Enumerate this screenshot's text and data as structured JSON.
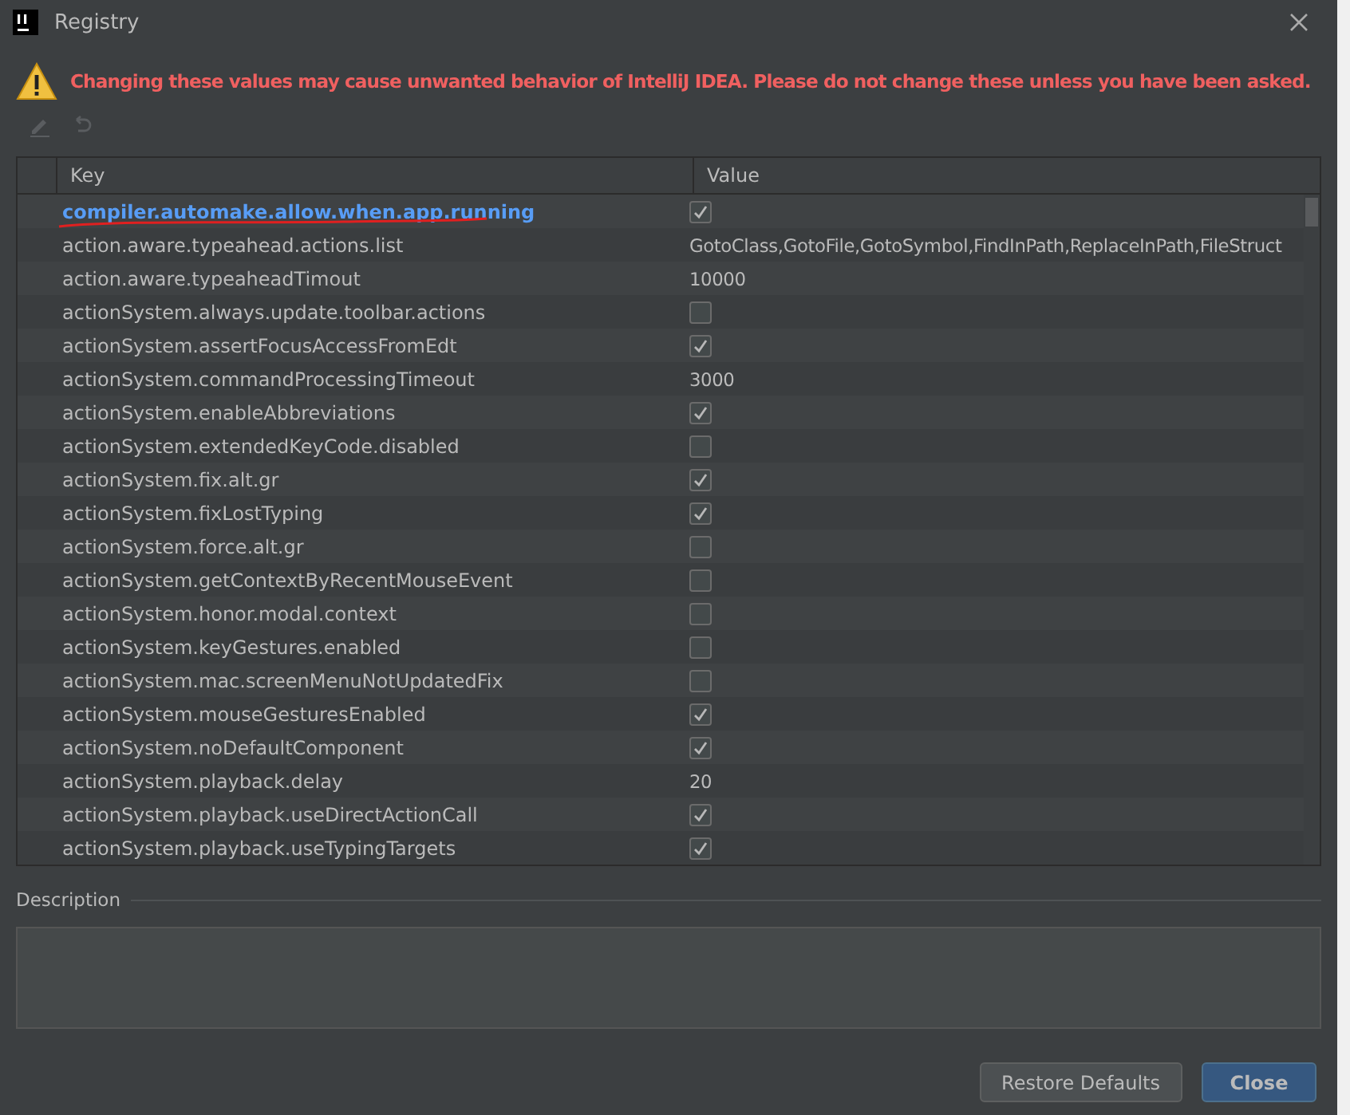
{
  "window": {
    "title": "Registry"
  },
  "warning": "Changing these values may cause unwanted behavior of IntelliJ IDEA. Please do not change these unless you have been asked.",
  "table": {
    "columns": [
      "Key",
      "Value"
    ],
    "rows": [
      {
        "key": "compiler.automake.allow.when.app.running",
        "modified": true,
        "kind": "checkbox",
        "checked": true
      },
      {
        "key": "action.aware.typeahead.actions.list",
        "modified": false,
        "kind": "text",
        "value": "GotoClass,GotoFile,GotoSymbol,FindInPath,ReplaceInPath,FileStruct"
      },
      {
        "key": "action.aware.typeaheadTimout",
        "modified": false,
        "kind": "text",
        "value": "10000"
      },
      {
        "key": "actionSystem.always.update.toolbar.actions",
        "modified": false,
        "kind": "checkbox",
        "checked": false
      },
      {
        "key": "actionSystem.assertFocusAccessFromEdt",
        "modified": false,
        "kind": "checkbox",
        "checked": true
      },
      {
        "key": "actionSystem.commandProcessingTimeout",
        "modified": false,
        "kind": "text",
        "value": "3000"
      },
      {
        "key": "actionSystem.enableAbbreviations",
        "modified": false,
        "kind": "checkbox",
        "checked": true
      },
      {
        "key": "actionSystem.extendedKeyCode.disabled",
        "modified": false,
        "kind": "checkbox",
        "checked": false
      },
      {
        "key": "actionSystem.fix.alt.gr",
        "modified": false,
        "kind": "checkbox",
        "checked": true
      },
      {
        "key": "actionSystem.fixLostTyping",
        "modified": false,
        "kind": "checkbox",
        "checked": true
      },
      {
        "key": "actionSystem.force.alt.gr",
        "modified": false,
        "kind": "checkbox",
        "checked": false
      },
      {
        "key": "actionSystem.getContextByRecentMouseEvent",
        "modified": false,
        "kind": "checkbox",
        "checked": false
      },
      {
        "key": "actionSystem.honor.modal.context",
        "modified": false,
        "kind": "checkbox",
        "checked": false
      },
      {
        "key": "actionSystem.keyGestures.enabled",
        "modified": false,
        "kind": "checkbox",
        "checked": false
      },
      {
        "key": "actionSystem.mac.screenMenuNotUpdatedFix",
        "modified": false,
        "kind": "checkbox",
        "checked": false
      },
      {
        "key": "actionSystem.mouseGesturesEnabled",
        "modified": false,
        "kind": "checkbox",
        "checked": true
      },
      {
        "key": "actionSystem.noDefaultComponent",
        "modified": false,
        "kind": "checkbox",
        "checked": true
      },
      {
        "key": "actionSystem.playback.delay",
        "modified": false,
        "kind": "text",
        "value": "20"
      },
      {
        "key": "actionSystem.playback.useDirectActionCall",
        "modified": false,
        "kind": "checkbox",
        "checked": true
      },
      {
        "key": "actionSystem.playback.useTypingTargets",
        "modified": false,
        "kind": "checkbox",
        "checked": true
      }
    ]
  },
  "description": {
    "label": "Description"
  },
  "buttons": [
    {
      "label": "Restore Defaults",
      "default": false
    },
    {
      "label": "Close",
      "default": true
    }
  ]
}
